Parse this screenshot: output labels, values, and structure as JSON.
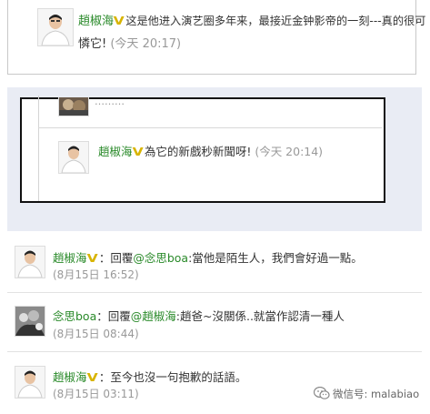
{
  "vip_badge": "V",
  "top_comment": {
    "user": "趙椒海",
    "text": "这是他进入演艺圈多年来，最接近金钟影帝的一刻---真的很可",
    "text_cont": "憐它!",
    "time": "(今天 20:17)"
  },
  "nested": {
    "hidden_text": "………",
    "comment": {
      "user": "趙椒海",
      "text": "為它的新戲秒新聞呀!",
      "time": "(今天 20:14)"
    }
  },
  "comments": [
    {
      "user": "趙椒海",
      "sep": "：",
      "prefix": "回覆",
      "mention": "@念思boa",
      "text": ":當他是陌生人，我們會好過一點。",
      "time": "(8月15日 16:52)"
    },
    {
      "user": "念思boa",
      "sep": "：",
      "prefix": "回覆",
      "mention": "@趙椒海",
      "text": ":趙爸~沒關係..就當作認清一種人",
      "time": "(8月15日 08:44)"
    },
    {
      "user": "趙椒海",
      "sep": "：",
      "text": "至今也沒一句抱歉的話語。",
      "time": "(8月15日 03:11)"
    }
  ],
  "watermark": "微信号: malabiao"
}
